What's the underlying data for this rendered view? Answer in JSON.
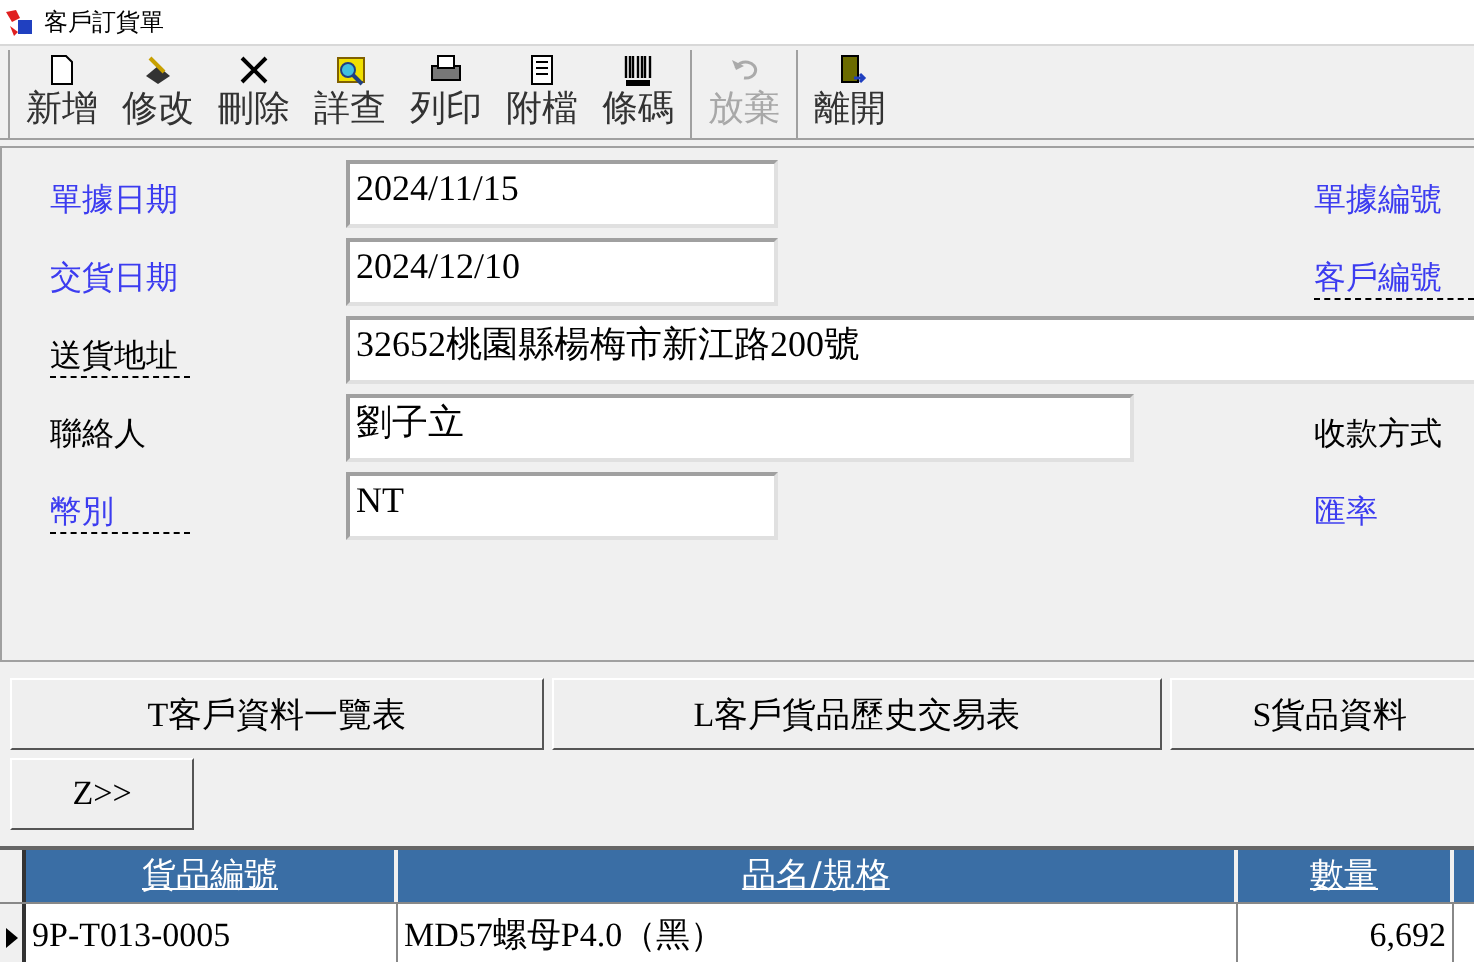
{
  "window": {
    "title": "客戶訂貨單"
  },
  "toolbar": [
    [
      {
        "label": "新增",
        "disabled": false
      },
      {
        "label": "修改",
        "disabled": false
      },
      {
        "label": "刪除",
        "disabled": false
      },
      {
        "label": "詳查",
        "disabled": false
      },
      {
        "label": "列印",
        "disabled": false
      },
      {
        "label": "附檔",
        "disabled": false
      },
      {
        "label": "條碼",
        "disabled": false
      }
    ],
    [
      {
        "label": "放棄",
        "disabled": true
      }
    ],
    [
      {
        "label": "離開",
        "disabled": false
      }
    ]
  ],
  "form": [
    {
      "label": {
        "text": "單據日期",
        "color": "#3c3cf0",
        "dashed": false
      },
      "value": "2024/11/15",
      "side_label": {
        "text": "單據編號",
        "color": "#3c3cf0",
        "dashed": false
      }
    },
    {
      "label": {
        "text": "交貨日期",
        "color": "#3c3cf0",
        "dashed": false
      },
      "value": "2024/12/10",
      "side_label": {
        "text": "客戶編號",
        "color": "#3c3cf0",
        "dashed": true
      }
    },
    {
      "label": {
        "text": "送貨地址",
        "color": "#000000",
        "dashed": true
      },
      "value": "32652桃園縣楊梅市新江路200號"
    },
    {
      "label": {
        "text": "聯絡人",
        "color": "#000000",
        "dashed": false
      },
      "value": "劉子立",
      "side_label": {
        "text": "收款方式",
        "color": "#000000",
        "dashed": false
      }
    },
    {
      "label": {
        "text": "幣別",
        "color": "#3c3cf0",
        "dashed": true
      },
      "value": "NT",
      "side_label": {
        "text": "匯率",
        "color": "#3c3cf0",
        "dashed": false
      }
    }
  ],
  "actions": [
    [
      "T客戶資料一覽表",
      "L客戶貨品歷史交易表",
      "S貨品資料"
    ],
    [
      "Z>>"
    ]
  ],
  "table": {
    "columns": [
      "貨品編號",
      "品名/規格",
      "數量"
    ],
    "rows": [
      {
        "current": true,
        "cells": [
          "9P-T013-0005",
          "MD57螺母P4.0（黑）",
          "6,692"
        ]
      }
    ]
  }
}
